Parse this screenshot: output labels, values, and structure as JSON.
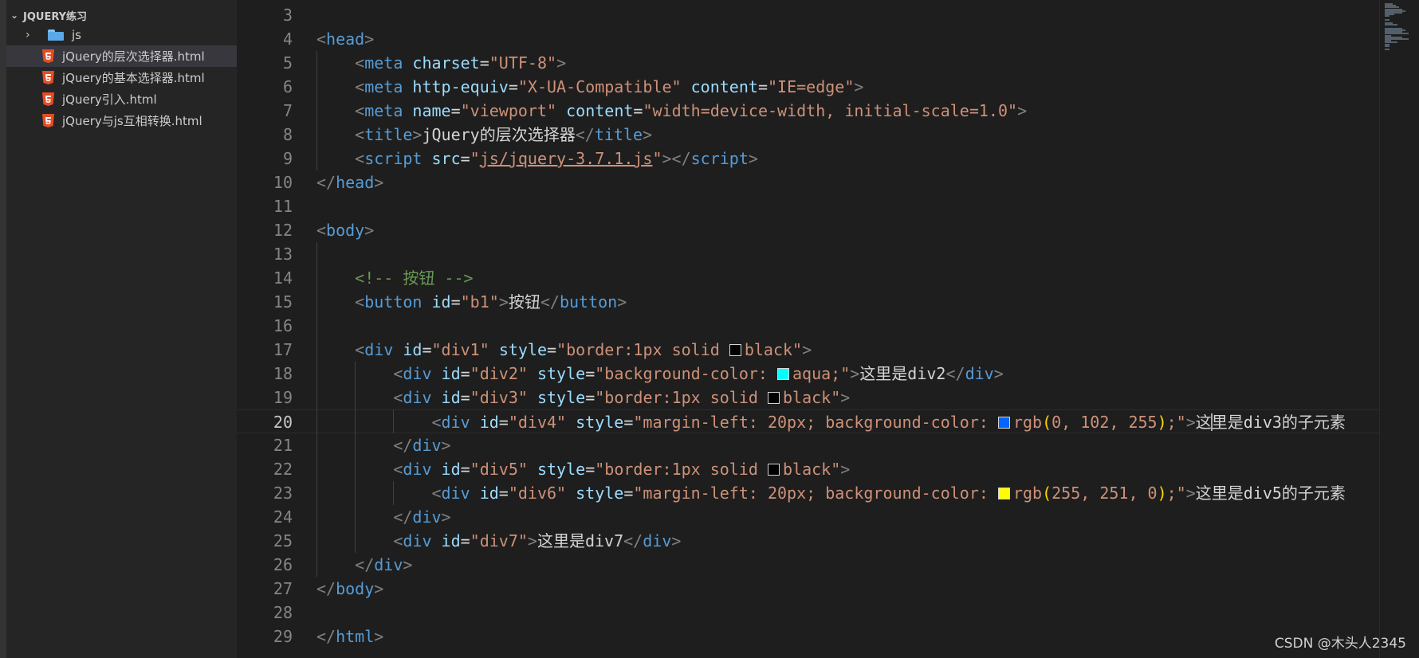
{
  "explorer": {
    "root_label": "JQUERY练习",
    "items": [
      {
        "type": "folder",
        "label": "js"
      },
      {
        "type": "file",
        "label": "jQuery的层次选择器.html",
        "selected": true
      },
      {
        "type": "file",
        "label": "jQuery的基本选择器.html"
      },
      {
        "type": "file",
        "label": "jQuery引入.html"
      },
      {
        "type": "file",
        "label": "jQuery与js互相转换.html"
      }
    ]
  },
  "editor": {
    "active_line": 20,
    "lines": [
      {
        "n": 3,
        "tokens": []
      },
      {
        "n": 4,
        "tokens": [
          [
            "br",
            "<"
          ],
          [
            "tag",
            "head"
          ],
          [
            "br",
            ">"
          ]
        ]
      },
      {
        "n": 5,
        "tokens": [
          [
            "br",
            "<"
          ],
          [
            "tag",
            "meta"
          ],
          [
            "txt",
            " "
          ],
          [
            "attr",
            "charset"
          ],
          [
            "txt",
            "="
          ],
          [
            "str",
            "\"UTF-8\""
          ],
          [
            "br",
            ">"
          ]
        ]
      },
      {
        "n": 6,
        "tokens": [
          [
            "br",
            "<"
          ],
          [
            "tag",
            "meta"
          ],
          [
            "txt",
            " "
          ],
          [
            "attr",
            "http-equiv"
          ],
          [
            "txt",
            "="
          ],
          [
            "str",
            "\"X-UA-Compatible\""
          ],
          [
            "txt",
            " "
          ],
          [
            "attr",
            "content"
          ],
          [
            "txt",
            "="
          ],
          [
            "str",
            "\"IE=edge\""
          ],
          [
            "br",
            ">"
          ]
        ]
      },
      {
        "n": 7,
        "tokens": [
          [
            "br",
            "<"
          ],
          [
            "tag",
            "meta"
          ],
          [
            "txt",
            " "
          ],
          [
            "attr",
            "name"
          ],
          [
            "txt",
            "="
          ],
          [
            "str",
            "\"viewport\""
          ],
          [
            "txt",
            " "
          ],
          [
            "attr",
            "content"
          ],
          [
            "txt",
            "="
          ],
          [
            "str",
            "\"width=device-width, initial-scale=1.0\""
          ],
          [
            "br",
            ">"
          ]
        ]
      },
      {
        "n": 8,
        "tokens": [
          [
            "br",
            "<"
          ],
          [
            "tag",
            "title"
          ],
          [
            "br",
            ">"
          ],
          [
            "txt",
            "jQuery的层次选择器"
          ],
          [
            "br",
            "</"
          ],
          [
            "tag",
            "title"
          ],
          [
            "br",
            ">"
          ]
        ]
      },
      {
        "n": 9,
        "tokens": [
          [
            "br",
            "<"
          ],
          [
            "tag",
            "script"
          ],
          [
            "txt",
            " "
          ],
          [
            "attr",
            "src"
          ],
          [
            "txt",
            "="
          ],
          [
            "str",
            "\""
          ],
          [
            "link",
            "js/jquery-3.7.1.js"
          ],
          [
            "str",
            "\""
          ],
          [
            "br",
            "></"
          ],
          [
            "tag",
            "script"
          ],
          [
            "br",
            ">"
          ]
        ]
      },
      {
        "n": 10,
        "tokens": [
          [
            "br",
            "</"
          ],
          [
            "tag",
            "head"
          ],
          [
            "br",
            ">"
          ]
        ]
      },
      {
        "n": 11,
        "tokens": []
      },
      {
        "n": 12,
        "tokens": [
          [
            "br",
            "<"
          ],
          [
            "tag",
            "body"
          ],
          [
            "br",
            ">"
          ]
        ]
      },
      {
        "n": 13,
        "tokens": []
      },
      {
        "n": 14,
        "tokens": [
          [
            "com",
            "<!-- 按钮 -->"
          ]
        ]
      },
      {
        "n": 15,
        "tokens": [
          [
            "br",
            "<"
          ],
          [
            "tag",
            "button"
          ],
          [
            "txt",
            " "
          ],
          [
            "attr",
            "id"
          ],
          [
            "txt",
            "="
          ],
          [
            "str",
            "\"b1\""
          ],
          [
            "br",
            ">"
          ],
          [
            "txt",
            "按钮"
          ],
          [
            "br",
            "</"
          ],
          [
            "tag",
            "button"
          ],
          [
            "br",
            ">"
          ]
        ]
      },
      {
        "n": 16,
        "tokens": []
      },
      {
        "n": 17,
        "tokens": [
          [
            "br",
            "<"
          ],
          [
            "tag",
            "div"
          ],
          [
            "txt",
            " "
          ],
          [
            "attr",
            "id"
          ],
          [
            "txt",
            "="
          ],
          [
            "str",
            "\"div1\""
          ],
          [
            "txt",
            " "
          ],
          [
            "attr",
            "style"
          ],
          [
            "txt",
            "="
          ],
          [
            "str",
            "\"border:1px solid "
          ],
          [
            "swatch",
            "#000000"
          ],
          [
            "str",
            "black\""
          ],
          [
            "br",
            ">"
          ]
        ]
      },
      {
        "n": 18,
        "tokens": [
          [
            "br",
            "<"
          ],
          [
            "tag",
            "div"
          ],
          [
            "txt",
            " "
          ],
          [
            "attr",
            "id"
          ],
          [
            "txt",
            "="
          ],
          [
            "str",
            "\"div2\""
          ],
          [
            "txt",
            " "
          ],
          [
            "attr",
            "style"
          ],
          [
            "txt",
            "="
          ],
          [
            "str",
            "\"background-color: "
          ],
          [
            "swatch",
            "#00ffff"
          ],
          [
            "str",
            "aqua;\""
          ],
          [
            "br",
            ">"
          ],
          [
            "txt",
            "这里是div2"
          ],
          [
            "br",
            "</"
          ],
          [
            "tag",
            "div"
          ],
          [
            "br",
            ">"
          ]
        ]
      },
      {
        "n": 19,
        "tokens": [
          [
            "br",
            "<"
          ],
          [
            "tag",
            "div"
          ],
          [
            "txt",
            " "
          ],
          [
            "attr",
            "id"
          ],
          [
            "txt",
            "="
          ],
          [
            "str",
            "\"div3\""
          ],
          [
            "txt",
            " "
          ],
          [
            "attr",
            "style"
          ],
          [
            "txt",
            "="
          ],
          [
            "str",
            "\"border:1px solid "
          ],
          [
            "swatch",
            "#000000"
          ],
          [
            "str",
            "black\""
          ],
          [
            "br",
            ">"
          ]
        ]
      },
      {
        "n": 20,
        "tokens": [
          [
            "br",
            "<"
          ],
          [
            "tag",
            "div"
          ],
          [
            "txt",
            " "
          ],
          [
            "attr",
            "id"
          ],
          [
            "txt",
            "="
          ],
          [
            "str",
            "\"div4\""
          ],
          [
            "txt",
            " "
          ],
          [
            "attr",
            "style"
          ],
          [
            "txt",
            "="
          ],
          [
            "str",
            "\"margin-left: 20px; background-color: "
          ],
          [
            "swatch",
            "#0066ff"
          ],
          [
            "str",
            "rgb"
          ],
          [
            "par",
            "("
          ],
          [
            "str",
            "0, 102, 255"
          ],
          [
            "par",
            ")"
          ],
          [
            "str",
            ";\""
          ],
          [
            "br",
            ">"
          ],
          [
            "txt",
            "这"
          ],
          [
            "cursor",
            ""
          ],
          [
            "txt",
            "里是div3的子元素"
          ]
        ]
      },
      {
        "n": 21,
        "tokens": [
          [
            "br",
            "</"
          ],
          [
            "tag",
            "div"
          ],
          [
            "br",
            ">"
          ]
        ]
      },
      {
        "n": 22,
        "tokens": [
          [
            "br",
            "<"
          ],
          [
            "tag",
            "div"
          ],
          [
            "txt",
            " "
          ],
          [
            "attr",
            "id"
          ],
          [
            "txt",
            "="
          ],
          [
            "str",
            "\"div5\""
          ],
          [
            "txt",
            " "
          ],
          [
            "attr",
            "style"
          ],
          [
            "txt",
            "="
          ],
          [
            "str",
            "\"border:1px solid "
          ],
          [
            "swatch",
            "#000000"
          ],
          [
            "str",
            "black\""
          ],
          [
            "br",
            ">"
          ]
        ]
      },
      {
        "n": 23,
        "tokens": [
          [
            "br",
            "<"
          ],
          [
            "tag",
            "div"
          ],
          [
            "txt",
            " "
          ],
          [
            "attr",
            "id"
          ],
          [
            "txt",
            "="
          ],
          [
            "str",
            "\"div6\""
          ],
          [
            "txt",
            " "
          ],
          [
            "attr",
            "style"
          ],
          [
            "txt",
            "="
          ],
          [
            "str",
            "\"margin-left: 20px; background-color: "
          ],
          [
            "swatch",
            "#fffb00"
          ],
          [
            "str",
            "rgb"
          ],
          [
            "par",
            "("
          ],
          [
            "str",
            "255, 251, 0"
          ],
          [
            "par",
            ")"
          ],
          [
            "str",
            ";\""
          ],
          [
            "br",
            ">"
          ],
          [
            "txt",
            "这里是div5的子元素"
          ]
        ]
      },
      {
        "n": 24,
        "tokens": [
          [
            "br",
            "</"
          ],
          [
            "tag",
            "div"
          ],
          [
            "br",
            ">"
          ]
        ]
      },
      {
        "n": 25,
        "tokens": [
          [
            "br",
            "<"
          ],
          [
            "tag",
            "div"
          ],
          [
            "txt",
            " "
          ],
          [
            "attr",
            "id"
          ],
          [
            "txt",
            "="
          ],
          [
            "str",
            "\"div7\""
          ],
          [
            "br",
            ">"
          ],
          [
            "txt",
            "这里是div7"
          ],
          [
            "br",
            "</"
          ],
          [
            "tag",
            "div"
          ],
          [
            "br",
            ">"
          ]
        ]
      },
      {
        "n": 26,
        "tokens": [
          [
            "br",
            "</"
          ],
          [
            "tag",
            "div"
          ],
          [
            "br",
            ">"
          ]
        ]
      },
      {
        "n": 27,
        "tokens": [
          [
            "br",
            "</"
          ],
          [
            "tag",
            "body"
          ],
          [
            "br",
            ">"
          ]
        ]
      },
      {
        "n": 28,
        "tokens": []
      },
      {
        "n": 29,
        "tokens": [
          [
            "br",
            "</"
          ],
          [
            "tag",
            "html"
          ],
          [
            "br",
            ">"
          ]
        ]
      }
    ]
  },
  "watermark": "CSDN @木头人2345",
  "colors": {
    "background": "#1e1e1e",
    "sidebar": "#252526",
    "selected": "#37373d"
  }
}
